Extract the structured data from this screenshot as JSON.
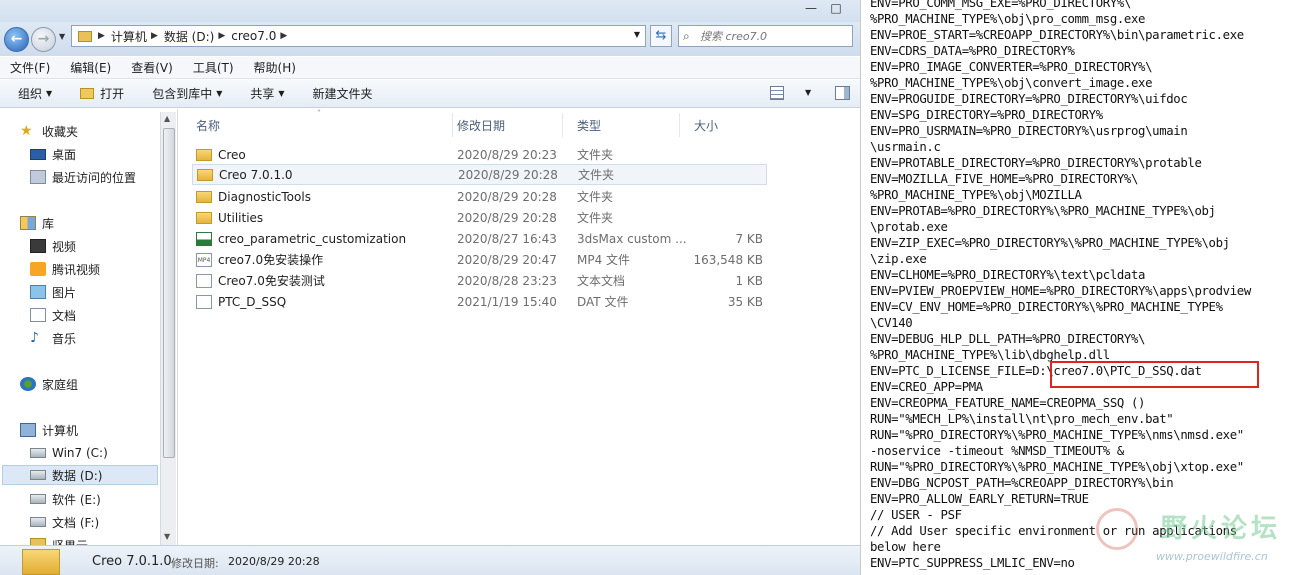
{
  "explorer": {
    "window_controls": {
      "minimize": "—",
      "maximize": "□"
    },
    "address": {
      "crumbs": [
        "计算机",
        "数据 (D:)",
        "creo7.0"
      ],
      "search_placeholder": "搜索 creo7.0"
    },
    "menu": [
      "文件(F)",
      "编辑(E)",
      "查看(V)",
      "工具(T)",
      "帮助(H)"
    ],
    "toolbar": {
      "organize": "组织",
      "open": "打开",
      "include_in_library": "包含到库中",
      "share": "共享",
      "new_folder": "新建文件夹"
    },
    "nav": {
      "favorites": "收藏夹",
      "desktop": "桌面",
      "recent": "最近访问的位置",
      "libraries": "库",
      "videos": "视频",
      "tencent_video": "腾讯视频",
      "pictures": "图片",
      "documents": "文档",
      "music": "音乐",
      "homegroup": "家庭组",
      "computer": "计算机",
      "drive_c": "Win7 (C:)",
      "drive_d": "数据 (D:)",
      "drive_e": "软件 (E:)",
      "drive_f": "文档 (F:)",
      "drive_more": "坚果云"
    },
    "columns": {
      "name": "名称",
      "date": "修改日期",
      "type": "类型",
      "size": "大小"
    },
    "files": [
      {
        "name": "Creo",
        "date": "2020/8/29 20:23",
        "type": "文件夹",
        "size": ""
      },
      {
        "name": "Creo 7.0.1.0",
        "date": "2020/8/29 20:28",
        "type": "文件夹",
        "size": ""
      },
      {
        "name": "DiagnosticTools",
        "date": "2020/8/29 20:28",
        "type": "文件夹",
        "size": ""
      },
      {
        "name": "Utilities",
        "date": "2020/8/29 20:28",
        "type": "文件夹",
        "size": ""
      },
      {
        "name": "creo_parametric_customization",
        "date": "2020/8/27 16:43",
        "type": "3dsMax custom ...",
        "size": "7 KB"
      },
      {
        "name": "creo7.0免安装操作",
        "date": "2020/8/29 20:47",
        "type": "MP4 文件",
        "size": "163,548 KB"
      },
      {
        "name": "Creo7.0免安装测试",
        "date": "2020/8/28 23:23",
        "type": "文本文档",
        "size": "1 KB"
      },
      {
        "name": "PTC_D_SSQ",
        "date": "2021/1/19 15:40",
        "type": "DAT 文件",
        "size": "35 KB"
      }
    ],
    "details": {
      "name": "Creo 7.0.1.0",
      "label": "修改日期:",
      "date": "2020/8/29 20:28"
    }
  },
  "env_text": {
    "lines": [
      "ENV=PRO_COMM_MSG_EXE=%PRO_DIRECTORY%\\",
      "%PRO_MACHINE_TYPE%\\obj\\pro_comm_msg.exe",
      "ENV=PROE_START=%CREOAPP_DIRECTORY%\\bin\\parametric.exe",
      "ENV=CDRS_DATA=%PRO_DIRECTORY%",
      "ENV=PRO_IMAGE_CONVERTER=%PRO_DIRECTORY%\\",
      "%PRO_MACHINE_TYPE%\\obj\\convert_image.exe",
      "ENV=PROGUIDE_DIRECTORY=%PRO_DIRECTORY%\\uifdoc",
      "ENV=SPG_DIRECTORY=%PRO_DIRECTORY%",
      "ENV=PRO_USRMAIN=%PRO_DIRECTORY%\\usrprog\\umain",
      "\\usrmain.c",
      "ENV=PROTABLE_DIRECTORY=%PRO_DIRECTORY%\\protable",
      "ENV=MOZILLA_FIVE_HOME=%PRO_DIRECTORY%\\",
      "%PRO_MACHINE_TYPE%\\obj\\MOZILLA",
      "ENV=PROTAB=%PRO_DIRECTORY%\\%PRO_MACHINE_TYPE%\\obj",
      "\\protab.exe",
      "ENV=ZIP_EXEC=%PRO_DIRECTORY%\\%PRO_MACHINE_TYPE%\\obj",
      "\\zip.exe",
      "ENV=CLHOME=%PRO_DIRECTORY%\\text\\pcldata",
      "ENV=PVIEW_PROEPVIEW_HOME=%PRO_DIRECTORY%\\apps\\prodview",
      "ENV=CV_ENV_HOME=%PRO_DIRECTORY%\\%PRO_MACHINE_TYPE%",
      "\\CV140",
      "ENV=DEBUG_HLP_DLL_PATH=%PRO_DIRECTORY%\\",
      "%PRO_MACHINE_TYPE%\\lib\\dbghelp.dll",
      "ENV=PTC_D_LICENSE_FILE=D:\\creo7.0\\PTC_D_SSQ.dat",
      "ENV=CREO_APP=PMA",
      "ENV=CREOPMA_FEATURE_NAME=CREOPMA_SSQ ()",
      "RUN=\"%MECH_LP%\\install\\nt\\pro_mech_env.bat\"",
      "RUN=\"%PRO_DIRECTORY%\\%PRO_MACHINE_TYPE%\\nms\\nmsd.exe\"",
      "-noservice -timeout %NMSD_TIMEOUT% &",
      "RUN=\"%PRO_DIRECTORY%\\%PRO_MACHINE_TYPE%\\obj\\xtop.exe\"",
      "ENV=DBG_NCPOST_PATH=%CREOAPP_DIRECTORY%\\bin",
      "ENV=PRO_ALLOW_EARLY_RETURN=TRUE",
      "// USER - PSF",
      "// Add User specific environment or run applications",
      "below here",
      "ENV=PTC_SUPPRESS_LMLIC_ENV=no"
    ],
    "watermark_text": "野火论坛",
    "watermark_url": "www.proewildfire.cn"
  }
}
